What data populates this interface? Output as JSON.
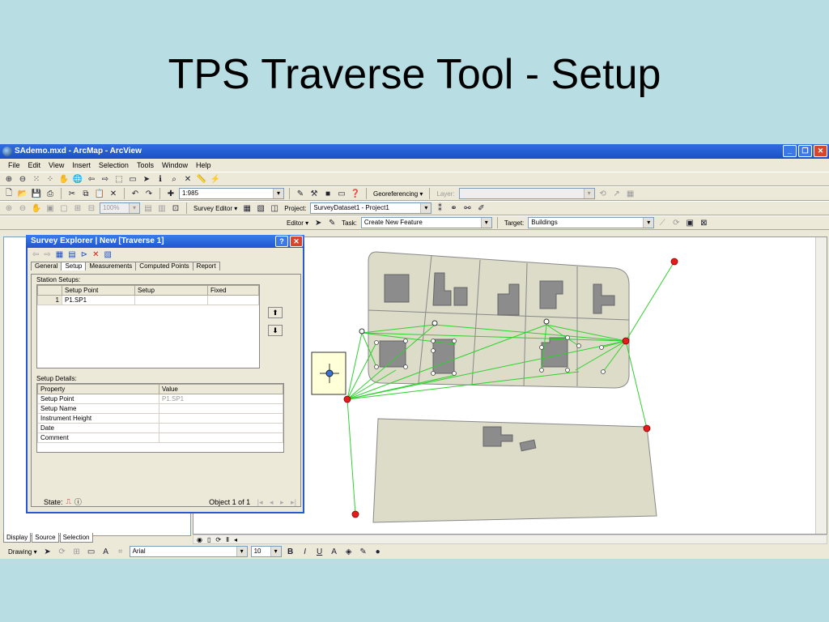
{
  "slide": {
    "title": "TPS Traverse Tool - Setup"
  },
  "window": {
    "title": "SAdemo.mxd - ArcMap - ArcView"
  },
  "menu": [
    "File",
    "Edit",
    "View",
    "Insert",
    "Selection",
    "Tools",
    "Window",
    "Help"
  ],
  "toolbar2": {
    "scale": "1:985",
    "georeferencing": "Georeferencing ▾",
    "layer_label": "Layer:"
  },
  "toolbar3": {
    "zoom": "100%",
    "survey_editor": "Survey Editor ▾",
    "project_label": "Project:",
    "project_value": "SurveyDataset1 - Project1"
  },
  "toolbar4": {
    "editor": "Editor ▾",
    "task_label": "Task:",
    "task_value": "Create New Feature",
    "target_label": "Target:",
    "target_value": "Buildings"
  },
  "toc_tabs": [
    "Display",
    "Source",
    "Selection"
  ],
  "dialog": {
    "title": "Survey Explorer  |  New [Traverse 1]",
    "tabs": [
      "General",
      "Setup",
      "Measurements",
      "Computed Points",
      "Report"
    ],
    "station_setups_label": "Station Setups:",
    "station_headers": [
      "Setup Point",
      "Setup",
      "Fixed"
    ],
    "station_rows": [
      {
        "num": "1",
        "point": "P1.SP1",
        "setup": "",
        "fixed": ""
      }
    ],
    "setup_details_label": "Setup Details:",
    "details_headers": [
      "Property",
      "Value"
    ],
    "details_rows": [
      {
        "prop": "Setup Point",
        "value": "P1.SP1"
      },
      {
        "prop": "Setup Name",
        "value": ""
      },
      {
        "prop": "Instrument Height",
        "value": ""
      },
      {
        "prop": "Date",
        "value": ""
      },
      {
        "prop": "Comment",
        "value": ""
      }
    ],
    "state_label": "State:",
    "object_count": "Object 1 of 1"
  },
  "drawbar": {
    "drawing": "Drawing ▾",
    "font": "Arial",
    "size": "10",
    "bold": "B",
    "italic": "I",
    "underline": "U"
  }
}
